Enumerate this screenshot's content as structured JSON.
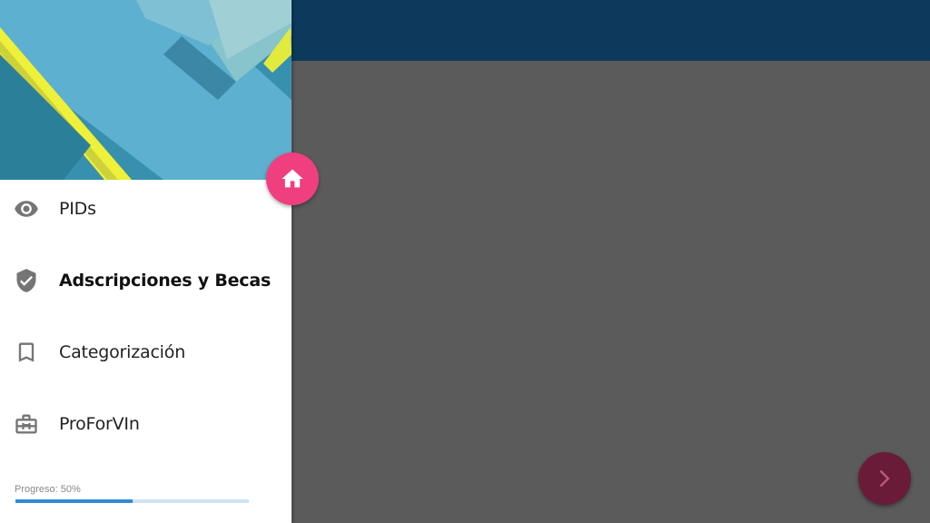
{
  "menu": {
    "items": [
      {
        "label": "PIDs",
        "icon": "eye-icon"
      },
      {
        "label": "Adscripciones y Becas",
        "icon": "verified-shield-icon",
        "active": true
      },
      {
        "label": "Categorización",
        "icon": "bookmark-icon"
      },
      {
        "label": "ProForVIn",
        "icon": "briefcase-icon"
      }
    ]
  },
  "progress": {
    "label": "Progreso: 50%",
    "value": 0.5
  },
  "colors": {
    "app_bar": "#0d3a5c",
    "fab_home": "#ef3f7f",
    "fab_next": "#6a1b38",
    "progress_fill": "#2f8ad8"
  },
  "icons": {
    "home_button": "home-icon",
    "next_button": "chevron-right-icon"
  }
}
